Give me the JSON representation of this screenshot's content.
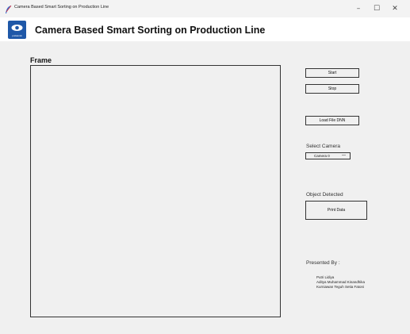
{
  "window": {
    "title": "Camera Based Smart Sorting on Production Line",
    "minimize": "–",
    "maximize": "☐",
    "close": "✕"
  },
  "header": {
    "logo_text": "politeknik",
    "app_title": "Camera Based Smart Sorting on Production Line"
  },
  "frame": {
    "label": "Frame"
  },
  "controls": {
    "start": "Start",
    "stop": "Stop",
    "load_dnn": "Load File DNN",
    "select_camera_label": "Select Camera",
    "camera_value": "Camera 0",
    "camera_arrow": "—",
    "object_detected_label": "Object Detected",
    "print_data": "Print Data"
  },
  "credits": {
    "heading": "Presented By :",
    "names": [
      "Putri Lidiya",
      "Aditya Muhammad Kinandhika",
      "Kurniawan Teguh Setia Fatoni"
    ]
  },
  "colors": {
    "logo_bg": "#1f58a8",
    "background": "#f0f0f0",
    "header_bg": "#ffffff"
  }
}
